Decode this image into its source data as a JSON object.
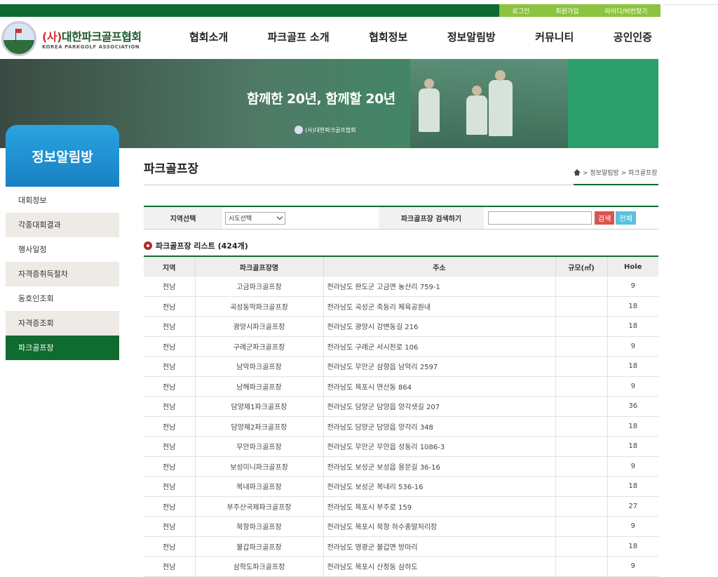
{
  "top_links": [
    "로그인",
    "회원가입",
    "아이디/비번찾기"
  ],
  "logo": {
    "paren": "(사)",
    "name": "대한파크골프협회",
    "sub": "KOREA PARKGOLF ASSOCIATION"
  },
  "nav": [
    "협회소개",
    "파크골프 소개",
    "협회정보",
    "정보알림방",
    "커뮤니티",
    "공인인증"
  ],
  "banner": {
    "title": "함께한 20년, 함께할 20년",
    "logo_text": "(사)대한파크골프협회"
  },
  "sidebar": {
    "title": "정보알림방",
    "items": [
      {
        "label": "대회정보"
      },
      {
        "label": "각종대회결과"
      },
      {
        "label": "행사일정"
      },
      {
        "label": "자격증취득절차"
      },
      {
        "label": "동호인조회"
      },
      {
        "label": "자격증조회"
      },
      {
        "label": "파크골프장"
      }
    ]
  },
  "page": {
    "title": "파크골프장",
    "breadcrumb": "> 정보알림방 > 파크골프장"
  },
  "search": {
    "region_label": "지역선택",
    "region_value": "시도선택",
    "search_label": "파크골프장 검색하기",
    "search_button": "검색",
    "all_button": "전체"
  },
  "list": {
    "title": "파크골프장 리스트 (424개)",
    "columns": [
      "지역",
      "파크골프장명",
      "주소",
      "규모(㎡)",
      "Hole"
    ],
    "rows": [
      [
        "전남",
        "고금파크골프장",
        "전라남도 완도군 고금면 농산리 759-1",
        "",
        "9"
      ],
      [
        "전남",
        "곡성동악파크골프장",
        "전라남도 곡성군 죽동리 체육공원내",
        "",
        "18"
      ],
      [
        "전남",
        "광양시파크골프장",
        "전라남도 광양시 강변동길 216",
        "",
        "18"
      ],
      [
        "전남",
        "구례군파크골프장",
        "전라남도 구례군 서시천로 106",
        "",
        "9"
      ],
      [
        "전남",
        "남악파크골프장",
        "전라남도 무안군 삼향읍 남악리 2597",
        "",
        "18"
      ],
      [
        "전남",
        "남해파크골프장",
        "전라남도 목포시 연산동 864",
        "",
        "9"
      ],
      [
        "전남",
        "담양제1파크골프장",
        "전라남도 담양군 담양읍 양각샛길 207",
        "",
        "36"
      ],
      [
        "전남",
        "담양제2파크골프장",
        "전라남도 담양군 담양읍 양각리 348",
        "",
        "18"
      ],
      [
        "전남",
        "무안파크골프장",
        "전라남도 무안군 무안읍 성동리 1086-3",
        "",
        "18"
      ],
      [
        "전남",
        "보성미니파크골프장",
        "전라남도 보성군 보성읍 용문길 36-16",
        "",
        "9"
      ],
      [
        "전남",
        "복내파크골프장",
        "전라남도 보성군 복내리 536-16",
        "",
        "18"
      ],
      [
        "전남",
        "부주산국제파크골프장",
        "전라남도 목포시 부주로 159",
        "",
        "27"
      ],
      [
        "전남",
        "북항파크골프장",
        "전라남도 목포시 북항 하수종말처리장",
        "",
        "9"
      ],
      [
        "전남",
        "불갑파크골프장",
        "전라남도 영광군 불갑면 방마리",
        "",
        "18"
      ],
      [
        "전남",
        "삼학도파크골프장",
        "전라남도 목포시 산정동 삼하도",
        "",
        "9"
      ]
    ]
  }
}
